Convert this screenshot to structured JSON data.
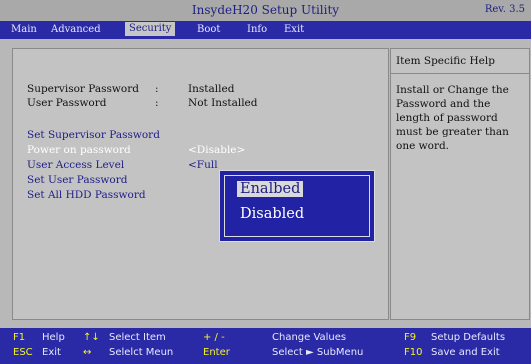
{
  "window": {
    "title": "InsydeH20 Setup Utility",
    "revision": "Rev. 3.5"
  },
  "menu": [
    {
      "label": "Main",
      "active": false
    },
    {
      "label": "Advanced",
      "active": false
    },
    {
      "label": "Security",
      "active": true
    },
    {
      "label": "Boot",
      "active": false
    },
    {
      "label": "Info",
      "active": false
    },
    {
      "label": "Exit",
      "active": false
    }
  ],
  "security": {
    "supervisor_password": {
      "label": "Supervisor Password",
      "sep": ":",
      "value": "Installed"
    },
    "user_password": {
      "label": "User Password",
      "sep": ":",
      "value": "Not Installed"
    },
    "set_supervisor_password": "Set Supervisor Password",
    "power_on_password": {
      "label": "Power on password",
      "value": "<Disable>"
    },
    "user_access_level": {
      "label": "User Access Level",
      "value": "<Full"
    },
    "set_user_password": "Set User Password",
    "set_all_hdd_password": "Set All HDD Password"
  },
  "popup": {
    "options": [
      "Enalbed",
      "Disabled"
    ],
    "selected_index": 0
  },
  "help": {
    "header": "Item Specific Help",
    "text": "Install or Change the Password and the length of password must be greater than one word."
  },
  "footer": [
    {
      "key": "F1",
      "label": "Help"
    },
    {
      "key": "ESC",
      "label": "Exit"
    },
    {
      "key": "↑↓",
      "label": "Select Item"
    },
    {
      "key": "↔",
      "label": "Selelct Meun"
    },
    {
      "key": "+ / -",
      "label": "Change Values"
    },
    {
      "key": "Enter",
      "label": "Select ► SubMenu"
    },
    {
      "key": "F9",
      "label": "Setup Defaults"
    },
    {
      "key": "F10",
      "label": "Save and Exit"
    }
  ],
  "colors": {
    "menu_bar": "#2a2aa6",
    "panel_bg": "#c3c3c3",
    "link_text": "#1e1e86",
    "footer_key": "#f2f22a",
    "popup_bg": "#2222a4"
  }
}
